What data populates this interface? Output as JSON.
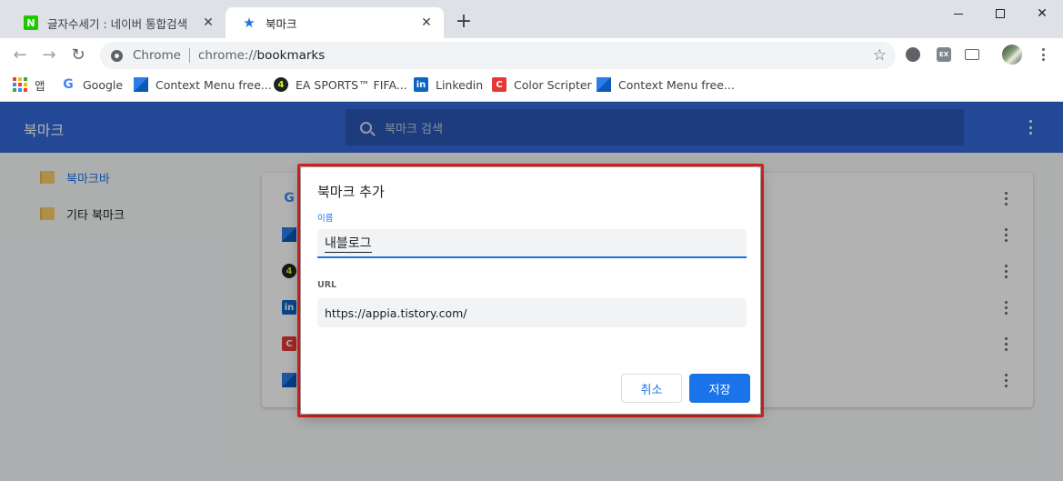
{
  "tabs": [
    {
      "title": "글자수세기 : 네이버 통합검색",
      "favicon": "naver-icon",
      "active": false
    },
    {
      "title": "북마크",
      "favicon": "star-icon",
      "active": true
    }
  ],
  "toolbar": {
    "omnibox_label": "Chrome",
    "url_prefix": "chrome://",
    "url_host": "bookmarks"
  },
  "bookmarks_bar": [
    {
      "label": "앱",
      "icon": "apps-grid-icon"
    },
    {
      "label": "Google",
      "icon": "google-icon"
    },
    {
      "label": "Context Menu free...",
      "icon": "context-menu-icon"
    },
    {
      "label": "EA SPORTS™ FIFA...",
      "icon": "ea-sports-icon"
    },
    {
      "label": "Linkedin",
      "icon": "linkedin-icon"
    },
    {
      "label": "Color Scripter",
      "icon": "color-scripter-icon"
    },
    {
      "label": "Context Menu free...",
      "icon": "context-menu-icon"
    }
  ],
  "page": {
    "title": "북마크",
    "search_placeholder": "북마크 검색",
    "folders": [
      {
        "label": "북마크바",
        "selected": true
      },
      {
        "label": "기타 북마크",
        "selected": false
      }
    ],
    "rows": [
      {
        "icon": "google-icon"
      },
      {
        "icon": "context-menu-icon"
      },
      {
        "icon": "ea-sports-icon"
      },
      {
        "icon": "linkedin-icon"
      },
      {
        "icon": "color-scripter-icon"
      },
      {
        "icon": "context-menu-icon"
      }
    ]
  },
  "dialog": {
    "title": "북마크 추가",
    "name_label": "이름",
    "name_value": "내블로그",
    "url_label": "URL",
    "url_value": "https://appia.tistory.com/",
    "cancel_label": "취소",
    "save_label": "저장"
  },
  "colors": {
    "header_blue": "#3367d6",
    "accent": "#1a73e8",
    "highlight_red": "#e0201f"
  }
}
